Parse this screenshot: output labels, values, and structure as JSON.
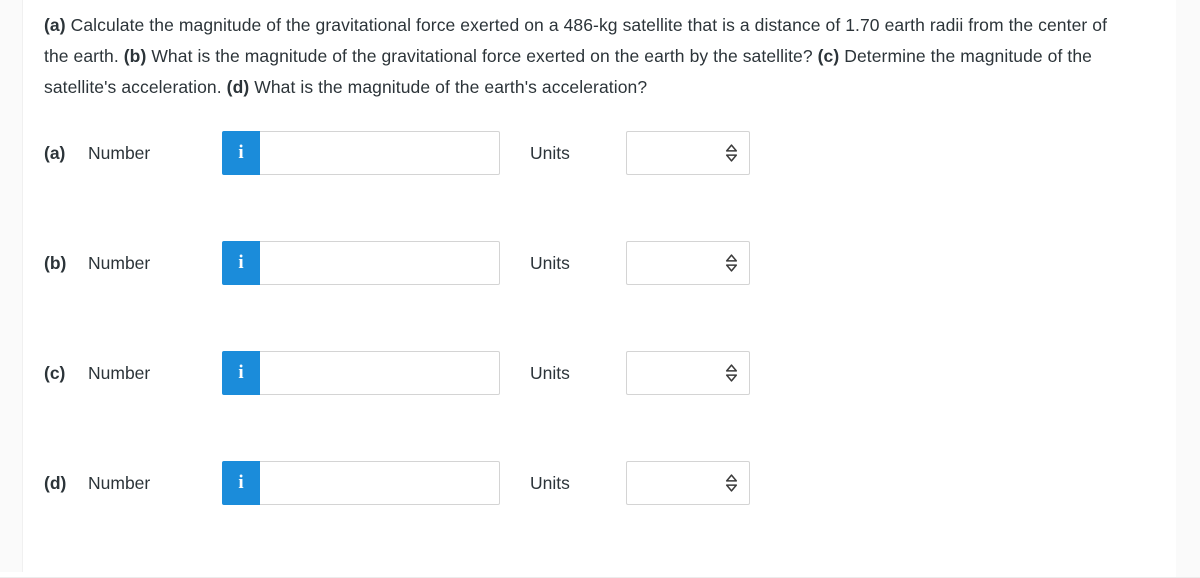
{
  "question": {
    "segments": [
      {
        "text": "(a)",
        "bold": true
      },
      {
        "text": " Calculate the magnitude of the gravitational force exerted on a 486-kg satellite that is a distance of 1.70 earth radii from the center of the earth. ",
        "bold": false
      },
      {
        "text": "(b)",
        "bold": true
      },
      {
        "text": " What is the magnitude of the gravitational force exerted on the earth by the satellite? ",
        "bold": false
      },
      {
        "text": "(c)",
        "bold": true
      },
      {
        "text": " Determine the magnitude of the satellite's acceleration. ",
        "bold": false
      },
      {
        "text": "(d)",
        "bold": true
      },
      {
        "text": " What is the magnitude of the earth's acceleration?",
        "bold": false
      }
    ]
  },
  "answers": {
    "number_label": "Number",
    "units_label": "Units",
    "info_icon": "info-icon",
    "info_glyph": "i",
    "select_icon": "chevron-up-down-icon",
    "number_placeholder": "",
    "units_placeholder": "",
    "rows": [
      {
        "part": "(a)",
        "number_value": "",
        "units_value": ""
      },
      {
        "part": "(b)",
        "number_value": "",
        "units_value": ""
      },
      {
        "part": "(c)",
        "number_value": "",
        "units_value": ""
      },
      {
        "part": "(d)",
        "number_value": "",
        "units_value": ""
      }
    ]
  },
  "colors": {
    "info_button_blue": "#1b8cda",
    "text": "#2c3439",
    "field_border": "#d4d4d4",
    "gutter": "#fafafa"
  }
}
